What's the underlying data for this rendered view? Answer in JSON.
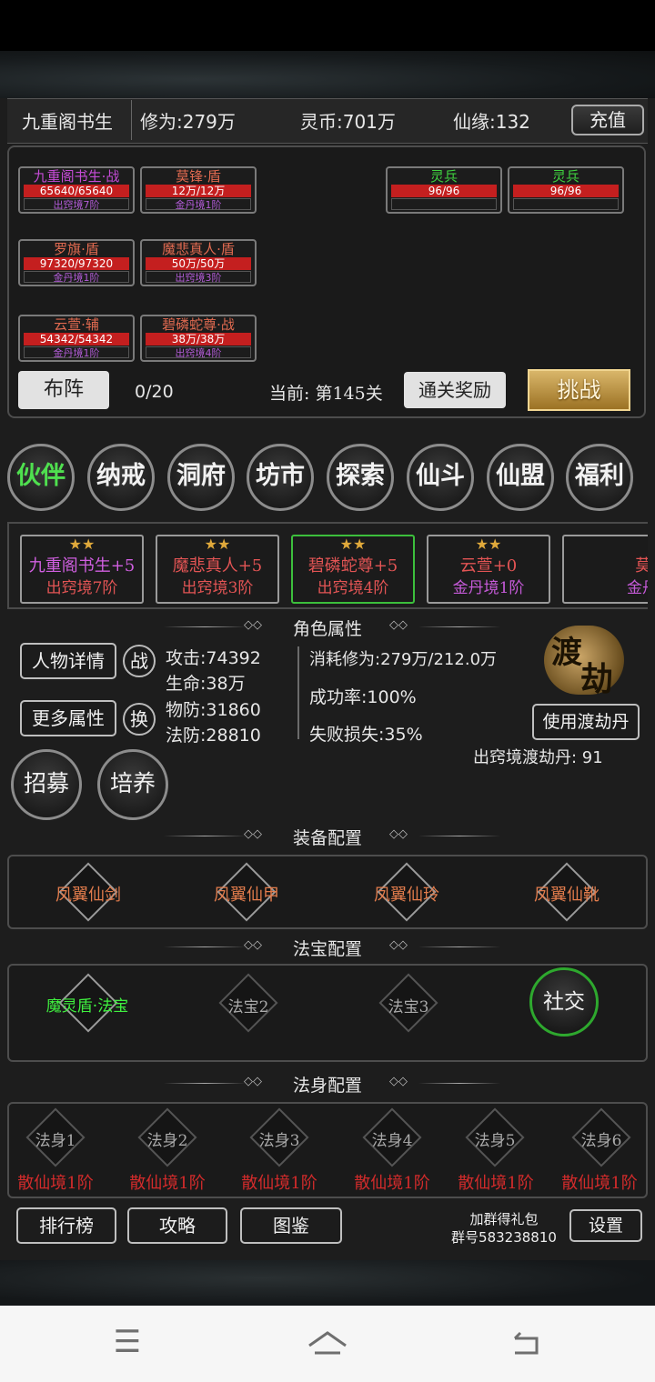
{
  "header": {
    "player_name": "九重阁书生",
    "cultivation": "修为:279万",
    "spirit_coin": "灵币:701万",
    "immortal_fate": "仙缘:132",
    "recharge_label": "充值"
  },
  "battle": {
    "allies": [
      {
        "name": "九重阁书生·战",
        "hp": "65640/65640",
        "realm": "出窍境7阶",
        "name_color": "#c54bd6"
      },
      {
        "name": "莫锋·盾",
        "hp": "12万/12万",
        "realm": "金丹境1阶",
        "name_color": "#e06a50"
      },
      {
        "name": "罗旗·盾",
        "hp": "97320/97320",
        "realm": "金丹境1阶",
        "name_color": "#e06a50"
      },
      {
        "name": "魔悲真人·盾",
        "hp": "50万/50万",
        "realm": "出窍境3阶",
        "name_color": "#e06a50"
      },
      {
        "name": "云萱·辅",
        "hp": "54342/54342",
        "realm": "金丹境1阶",
        "name_color": "#e06a50"
      },
      {
        "name": "碧磷蛇尊·战",
        "hp": "38万/38万",
        "realm": "出窍境4阶",
        "name_color": "#e06a50"
      }
    ],
    "enemies": [
      {
        "name": "灵兵",
        "hp": "96/96"
      },
      {
        "name": "灵兵",
        "hp": "96/96"
      }
    ],
    "formation_label": "布阵",
    "formation_count": "0/20",
    "current_stage": "当前: 第145关",
    "stage_reward_label": "通关奖励",
    "challenge_label": "挑战"
  },
  "menu": [
    "伙伴",
    "纳戒",
    "洞府",
    "坊市",
    "探索",
    "仙斗",
    "仙盟",
    "福利"
  ],
  "partners": [
    {
      "name": "九重阁书生+5",
      "realm": "出窍境7阶",
      "name_color": "#d05fe0",
      "realm_color": "#e25454",
      "stars": "★★"
    },
    {
      "name": "魔悲真人+5",
      "realm": "出窍境3阶",
      "name_color": "#e25454",
      "realm_color": "#e25454",
      "stars": "★★"
    },
    {
      "name": "碧磷蛇尊+5",
      "realm": "出窍境4阶",
      "name_color": "#e25454",
      "realm_color": "#e25454",
      "stars": "★★"
    },
    {
      "name": "云萱+0",
      "realm": "金丹境1阶",
      "name_color": "#e25454",
      "realm_color": "#c55ad8",
      "stars": "★★"
    },
    {
      "name": "莫锋·",
      "realm": "金丹境",
      "name_color": "#e25454",
      "realm_color": "#c55ad8",
      "stars": "★★"
    }
  ],
  "attributes": {
    "section_title": "角色属性",
    "detail_button": "人物详情",
    "battle_icon": "战",
    "more_button": "更多属性",
    "swap_icon": "换",
    "attack": "攻击:74392",
    "life": "生命:38万",
    "phys_def": "物防:31860",
    "magic_def": "法防:28810",
    "consume": "消耗修为:279万/212.0万",
    "success": "成功率:100%",
    "fail_loss": "失败损失:35%",
    "tribulation_badge_1": "渡",
    "tribulation_badge_2": "劫",
    "use_pill_button": "使用渡劫丹",
    "pill_count": "出窍境渡劫丹: 91",
    "recruit_button": "招募",
    "train_button": "培养"
  },
  "equipment": {
    "section_title": "装备配置",
    "items": [
      "凤翼仙剑",
      "凤翼仙甲",
      "凤翼仙玲",
      "凤翼仙靴"
    ]
  },
  "treasure": {
    "section_title": "法宝配置",
    "items": [
      "魔灵盾·法宝",
      "法宝2",
      "法宝3"
    ],
    "social_button": "社交"
  },
  "dharma_body": {
    "section_title": "法身配置",
    "items": [
      {
        "label": "法身1",
        "realm": "散仙境1阶"
      },
      {
        "label": "法身2",
        "realm": "散仙境1阶"
      },
      {
        "label": "法身3",
        "realm": "散仙境1阶"
      },
      {
        "label": "法身4",
        "realm": "散仙境1阶"
      },
      {
        "label": "法身5",
        "realm": "散仙境1阶"
      },
      {
        "label": "法身6",
        "realm": "散仙境1阶"
      }
    ]
  },
  "footer": {
    "ranking": "排行榜",
    "guide": "攻略",
    "codex": "图鉴",
    "group_text_1": "加群得礼包",
    "group_text_2": "群号583238810",
    "settings": "设置"
  },
  "system_nav": {
    "menu_icon": "menu-icon",
    "home_icon": "home-icon",
    "back_icon": "back-icon"
  }
}
